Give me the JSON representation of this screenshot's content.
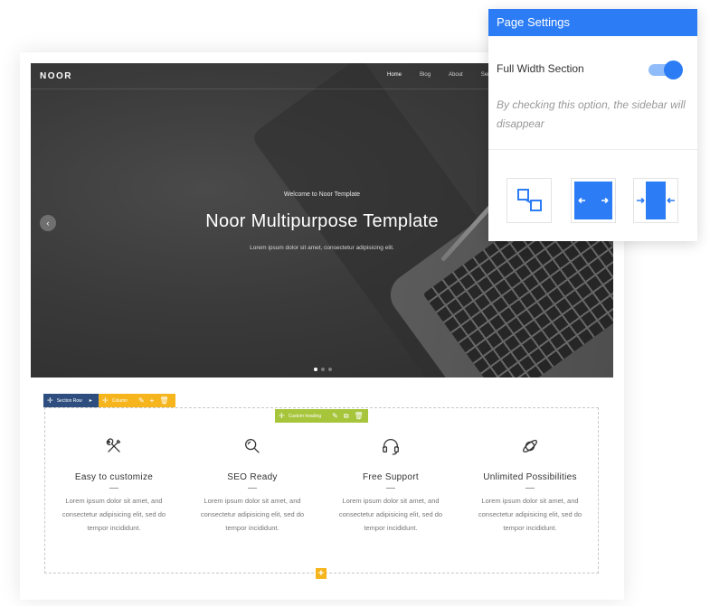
{
  "hero": {
    "logo": "NOOR",
    "nav": [
      "Home",
      "Blog",
      "About",
      "Service"
    ],
    "welcome": "Welcome to Noor Template",
    "title": "Noor Multipurpose Template",
    "subtitle": "Lorem ipsum dolor sit amet, consectetur adipisicing elit.",
    "prev_arrow": "‹"
  },
  "builder": {
    "section_row_label": "Section Row",
    "column_label": "Column",
    "custom_heading_label": "Custom heading",
    "add_symbol": "+"
  },
  "features": [
    {
      "icon": "tools-icon",
      "title": "Easy to customize",
      "text": [
        "Lorem ipsum dolor sit amet, and",
        "consectetur adipisicing elit, sed do",
        "tempor incididunt."
      ]
    },
    {
      "icon": "search-icon",
      "title": "SEO Ready",
      "text": [
        "Lorem ipsum dolor sit amet, and",
        "consectetur adipisicing elit, sed do",
        "tempor incididunt."
      ]
    },
    {
      "icon": "headset-icon",
      "title": "Free Support",
      "text": [
        "Lorem ipsum dolor sit amet, and",
        "consectetur adipisicing elit, sed do",
        "tempor incididunt."
      ]
    },
    {
      "icon": "planet-icon",
      "title": "Unlimited Possibilities",
      "text": [
        "Lorem ipsum dolor sit amet, and",
        "consectetur adipisicing elit, sed do",
        "tempor incididunt."
      ]
    }
  ],
  "settings": {
    "header": "Page Settings",
    "full_width_label": "Full Width Section",
    "full_width_on": true,
    "description": "By checking this option, the sidebar will disappear",
    "accent_color": "#2c7cf6"
  }
}
